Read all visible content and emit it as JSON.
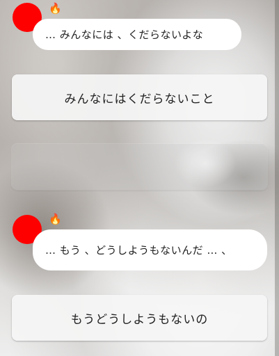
{
  "chat": [
    {
      "speaker_icon": "flame-icon",
      "flame_glyph": "🔥",
      "text": "… みんなには 、くだらないよな"
    },
    {
      "speaker_icon": "flame-icon",
      "flame_glyph": "🔥",
      "text": "… もう 、どうしようもないんだ … 、"
    }
  ],
  "options": [
    {
      "label": "みんなにはくだらないこと"
    },
    {
      "label": ""
    },
    {
      "label": "もうどうしようもないの"
    }
  ],
  "colors": {
    "avatar": "#ff0000",
    "bubble": "#ffffff",
    "option_bg": "#f5f5f5"
  }
}
